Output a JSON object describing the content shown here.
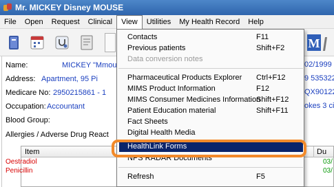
{
  "window": {
    "title": "Mr. MICKEY Disney MOUSE"
  },
  "menubar": {
    "items": [
      "File",
      "Open",
      "Request",
      "Clinical",
      "View",
      "Utilities",
      "My Health Record",
      "Help"
    ],
    "open_item": "View"
  },
  "view_menu": {
    "groups": [
      [
        {
          "label": "Contacts",
          "shortcut": "F11",
          "enabled": true
        },
        {
          "label": "Previous patients",
          "shortcut": "Shift+F2",
          "enabled": true
        },
        {
          "label": "Data conversion notes",
          "shortcut": "",
          "enabled": false
        }
      ],
      [
        {
          "label": "Pharmaceutical Products Explorer",
          "shortcut": "Ctrl+F12",
          "enabled": true
        },
        {
          "label": "MIMS Product Information",
          "shortcut": "F12",
          "enabled": true
        },
        {
          "label": "MIMS Consumer Medicines Information",
          "shortcut": "Shift+F12",
          "enabled": true
        },
        {
          "label": "Patient Education material",
          "shortcut": "Shift+F11",
          "enabled": true
        },
        {
          "label": "Fact Sheets",
          "shortcut": "",
          "enabled": true
        },
        {
          "label": "Digital Health Media",
          "shortcut": "",
          "enabled": true
        },
        {
          "label": "HealthLink Forms",
          "shortcut": "",
          "enabled": true,
          "highlighted": true
        },
        {
          "label": "NPS RADAR Documents",
          "shortcut": "",
          "enabled": true
        }
      ],
      [
        {
          "label": "Refresh",
          "shortcut": "F5",
          "enabled": true
        }
      ]
    ]
  },
  "patient": {
    "name_label": "Name:",
    "name_value": "MICKEY \"Mmou",
    "address_label": "Address:",
    "address_value": "Apartment, 95 Pi",
    "medicare_label": "Medicare No:",
    "medicare_value": "2950215861 - 1",
    "occupation_label": "Occupation:",
    "occupation_value": "Accountant",
    "blood_label": "Blood Group:",
    "allergies_label": "Allergies / Adverse Drug React",
    "right_values": [
      "02/1999",
      "9 535322",
      "QX901226",
      "okes 3 ci"
    ]
  },
  "allergy_grid": {
    "columns": [
      "Item",
      "Du"
    ],
    "rows": [
      {
        "item": "Oestradiol",
        "date": "03/"
      },
      {
        "item": "Penicillin",
        "date": "03/"
      }
    ]
  },
  "colors": {
    "accent": "#0a246a",
    "highlight_ring": "#f28a2a",
    "link": "#1a3fbf",
    "alert": "#d80000",
    "date": "#0a9a0a"
  },
  "icons": [
    "app-icon",
    "book-icon",
    "calendar-icon",
    "stethoscope-icon",
    "notes-icon",
    "mims-icon"
  ]
}
